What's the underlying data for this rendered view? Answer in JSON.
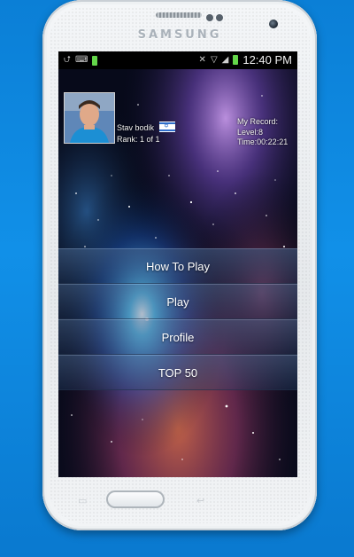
{
  "device": {
    "brand": "SAMSUNG"
  },
  "status_bar": {
    "time": "12:40 PM"
  },
  "user": {
    "name": "Stav bodik",
    "rank": "Rank: 1 of 1",
    "flag": "israel-flag-icon"
  },
  "record": {
    "title": "My Record:",
    "level": "Level:8",
    "time": "Time:00:22:21"
  },
  "menu": {
    "items": [
      {
        "label": "How To Play"
      },
      {
        "label": "Play"
      },
      {
        "label": "Profile"
      },
      {
        "label": "TOP 50"
      }
    ]
  },
  "colors": {
    "background": "#1190e8",
    "phone_body": "#eef1f3",
    "menu_band": "#46648c"
  }
}
